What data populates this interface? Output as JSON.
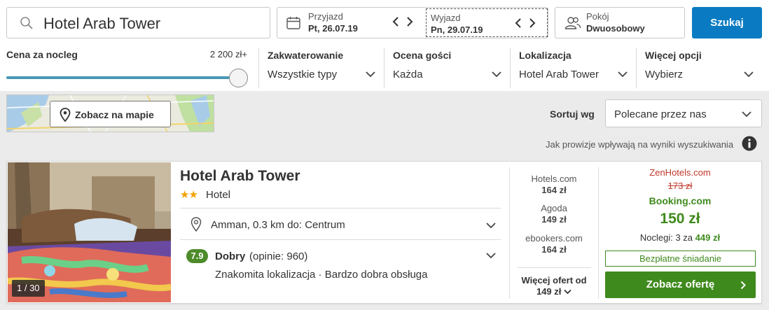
{
  "search": {
    "value": "Hotel Arab Tower",
    "icon": "search-icon"
  },
  "dates": {
    "checkin_label": "Przyjazd",
    "checkin_value": "Pt, 26.07.19",
    "checkout_label": "Wyjazd",
    "checkout_value": "Pn, 29.07.19"
  },
  "room": {
    "label": "Pokój",
    "value": "Dwuosobowy"
  },
  "search_button": "Szukaj",
  "filters": {
    "price_label": "Cena za nocleg",
    "price_max": "2 200 zł+",
    "price_level": 1.0,
    "accommodation_label": "Zakwaterowanie",
    "accommodation_value": "Wszystkie typy",
    "rating_label": "Ocena gości",
    "rating_value": "Każda",
    "location_label": "Lokalizacja",
    "location_value": "Hotel Arab Tower",
    "more_label": "Więcej opcji",
    "more_value": "Wybierz"
  },
  "map": {
    "button_label": "Zobacz na mapie"
  },
  "sort": {
    "label": "Sortuj wg",
    "value": "Polecane przez nas"
  },
  "commission_text": "Jak prowizje wpływają na wyniki wyszukiwania",
  "hotel": {
    "name": "Hotel Arab Tower",
    "stars": 2,
    "stars_text": "★★",
    "type": "Hotel",
    "photo_count": "1 / 30",
    "location": "Amman, 0.3 km do: Centrum",
    "rating_score": "7.9",
    "rating_word": "Dobry",
    "rating_count": "(opinie: 960)",
    "highlights": "Znakomita lokalizacja · Bardzo dobra obsługa",
    "providers": [
      {
        "name": "Hotels.com",
        "price": "164 zł"
      },
      {
        "name": "Agoda",
        "price": "149 zł"
      },
      {
        "name": "ebookers.com",
        "price": "164 zł"
      }
    ],
    "more_offers_line1": "Więcej ofert od",
    "more_offers_line2": "149 zł",
    "deal_provider": "ZenHotels.com",
    "deal_old_price": "173 zł",
    "best_provider": "Booking.com",
    "best_price": "150 zł",
    "nights_prefix": "Noclegi: 3 za",
    "nights_total": "449 zł",
    "breakfast": "Bezpłatne śniadanie",
    "offer_button": "Zobacz ofertę"
  },
  "colors": {
    "search_button": "#0a7bc2",
    "deal_green": "#3f8a1d",
    "deal_red": "#c0392b",
    "rating_badge": "#4d8b2a",
    "star": "#f2a100"
  }
}
